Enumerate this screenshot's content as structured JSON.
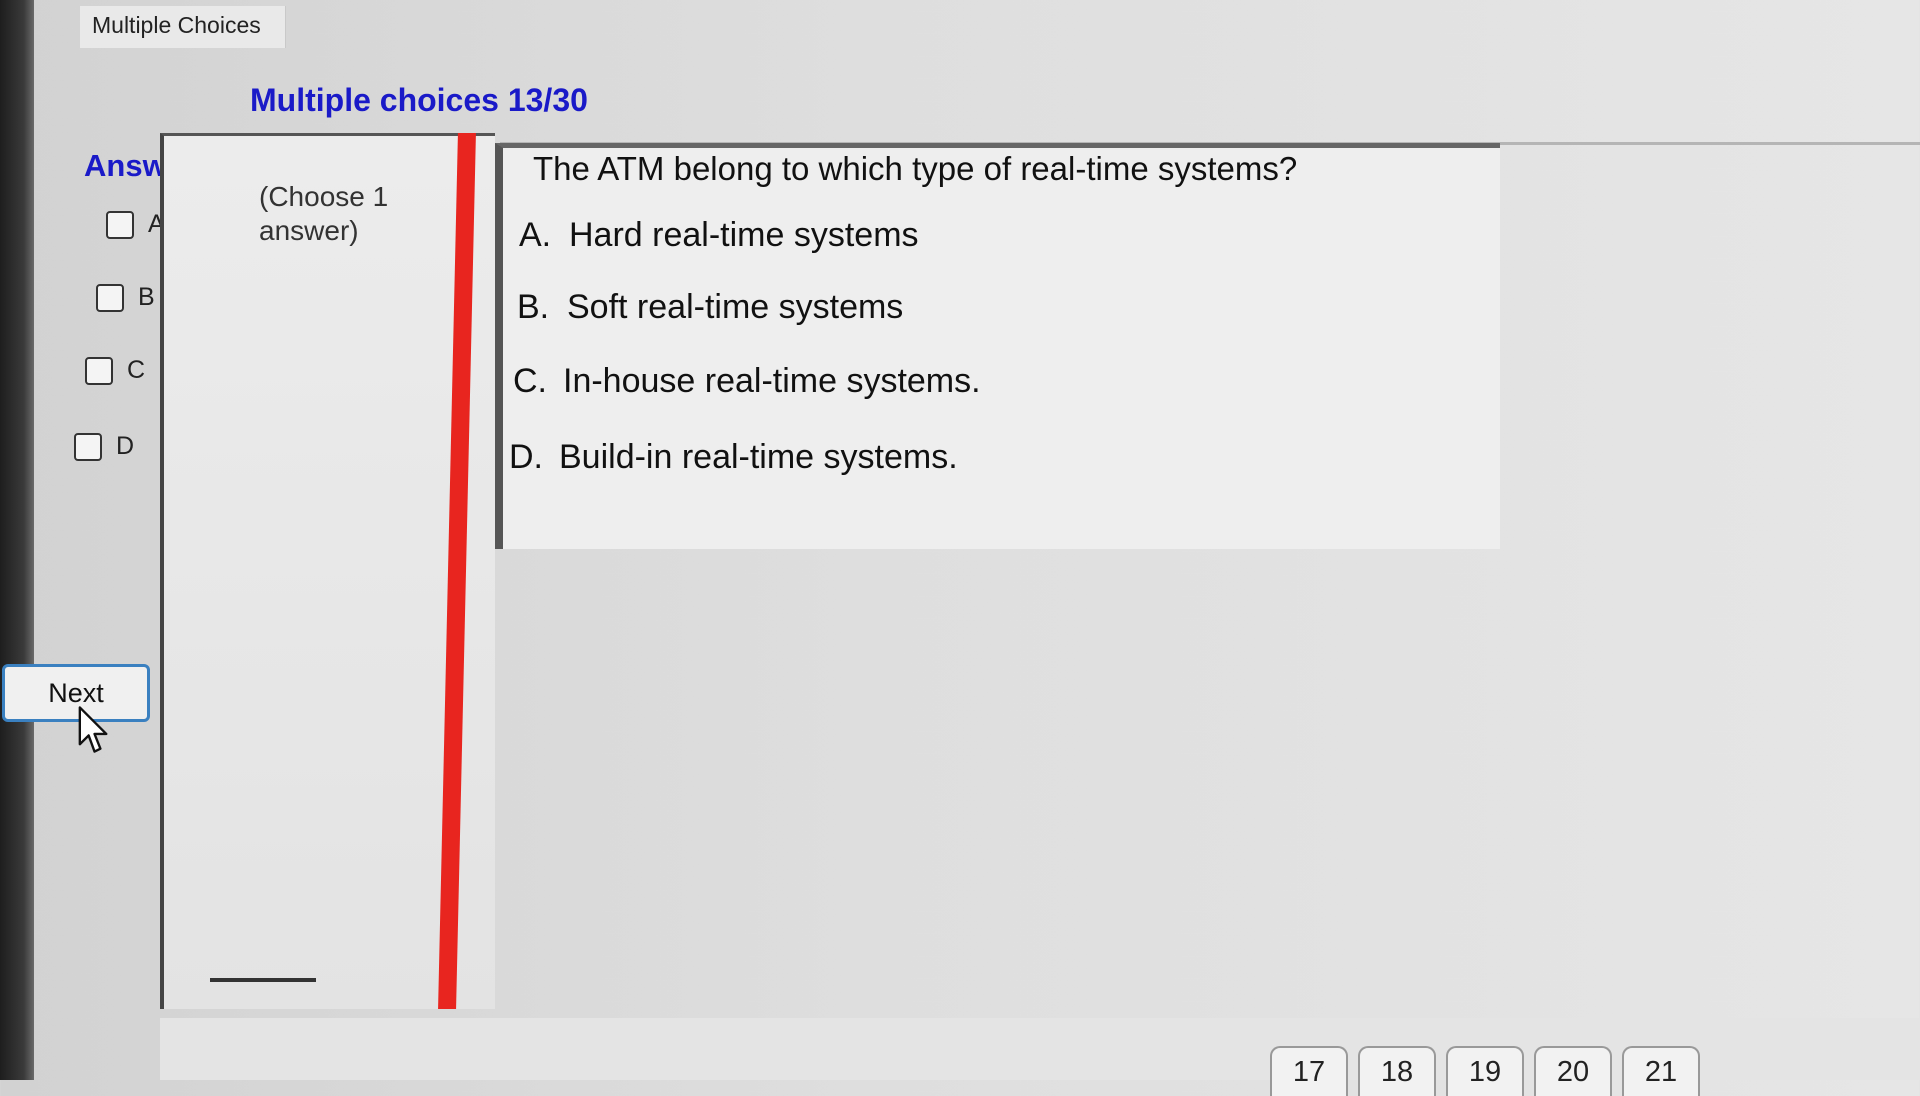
{
  "window": {
    "tab_label": "Multiple Choices"
  },
  "quiz": {
    "progress": "Multiple choices 13/30",
    "hint": "(Choose 1 answer)"
  },
  "answer": {
    "title": "Answer",
    "options": [
      {
        "letter": "A",
        "checked": false
      },
      {
        "letter": "B",
        "checked": false
      },
      {
        "letter": "C",
        "checked": false
      },
      {
        "letter": "D",
        "checked": false
      }
    ]
  },
  "question": {
    "text": "The ATM belong to which type of real-time systems?",
    "choices": [
      {
        "letter": "A.",
        "text": "Hard real-time systems"
      },
      {
        "letter": "B.",
        "text": "Soft real-time systems"
      },
      {
        "letter": "C.",
        "text": "In-house real-time systems."
      },
      {
        "letter": "D.",
        "text": "Build-in real-time systems."
      }
    ]
  },
  "buttons": {
    "next": "Next"
  },
  "pagination": {
    "visible_numbers": [
      "17",
      "18",
      "19",
      "20",
      "21"
    ]
  }
}
